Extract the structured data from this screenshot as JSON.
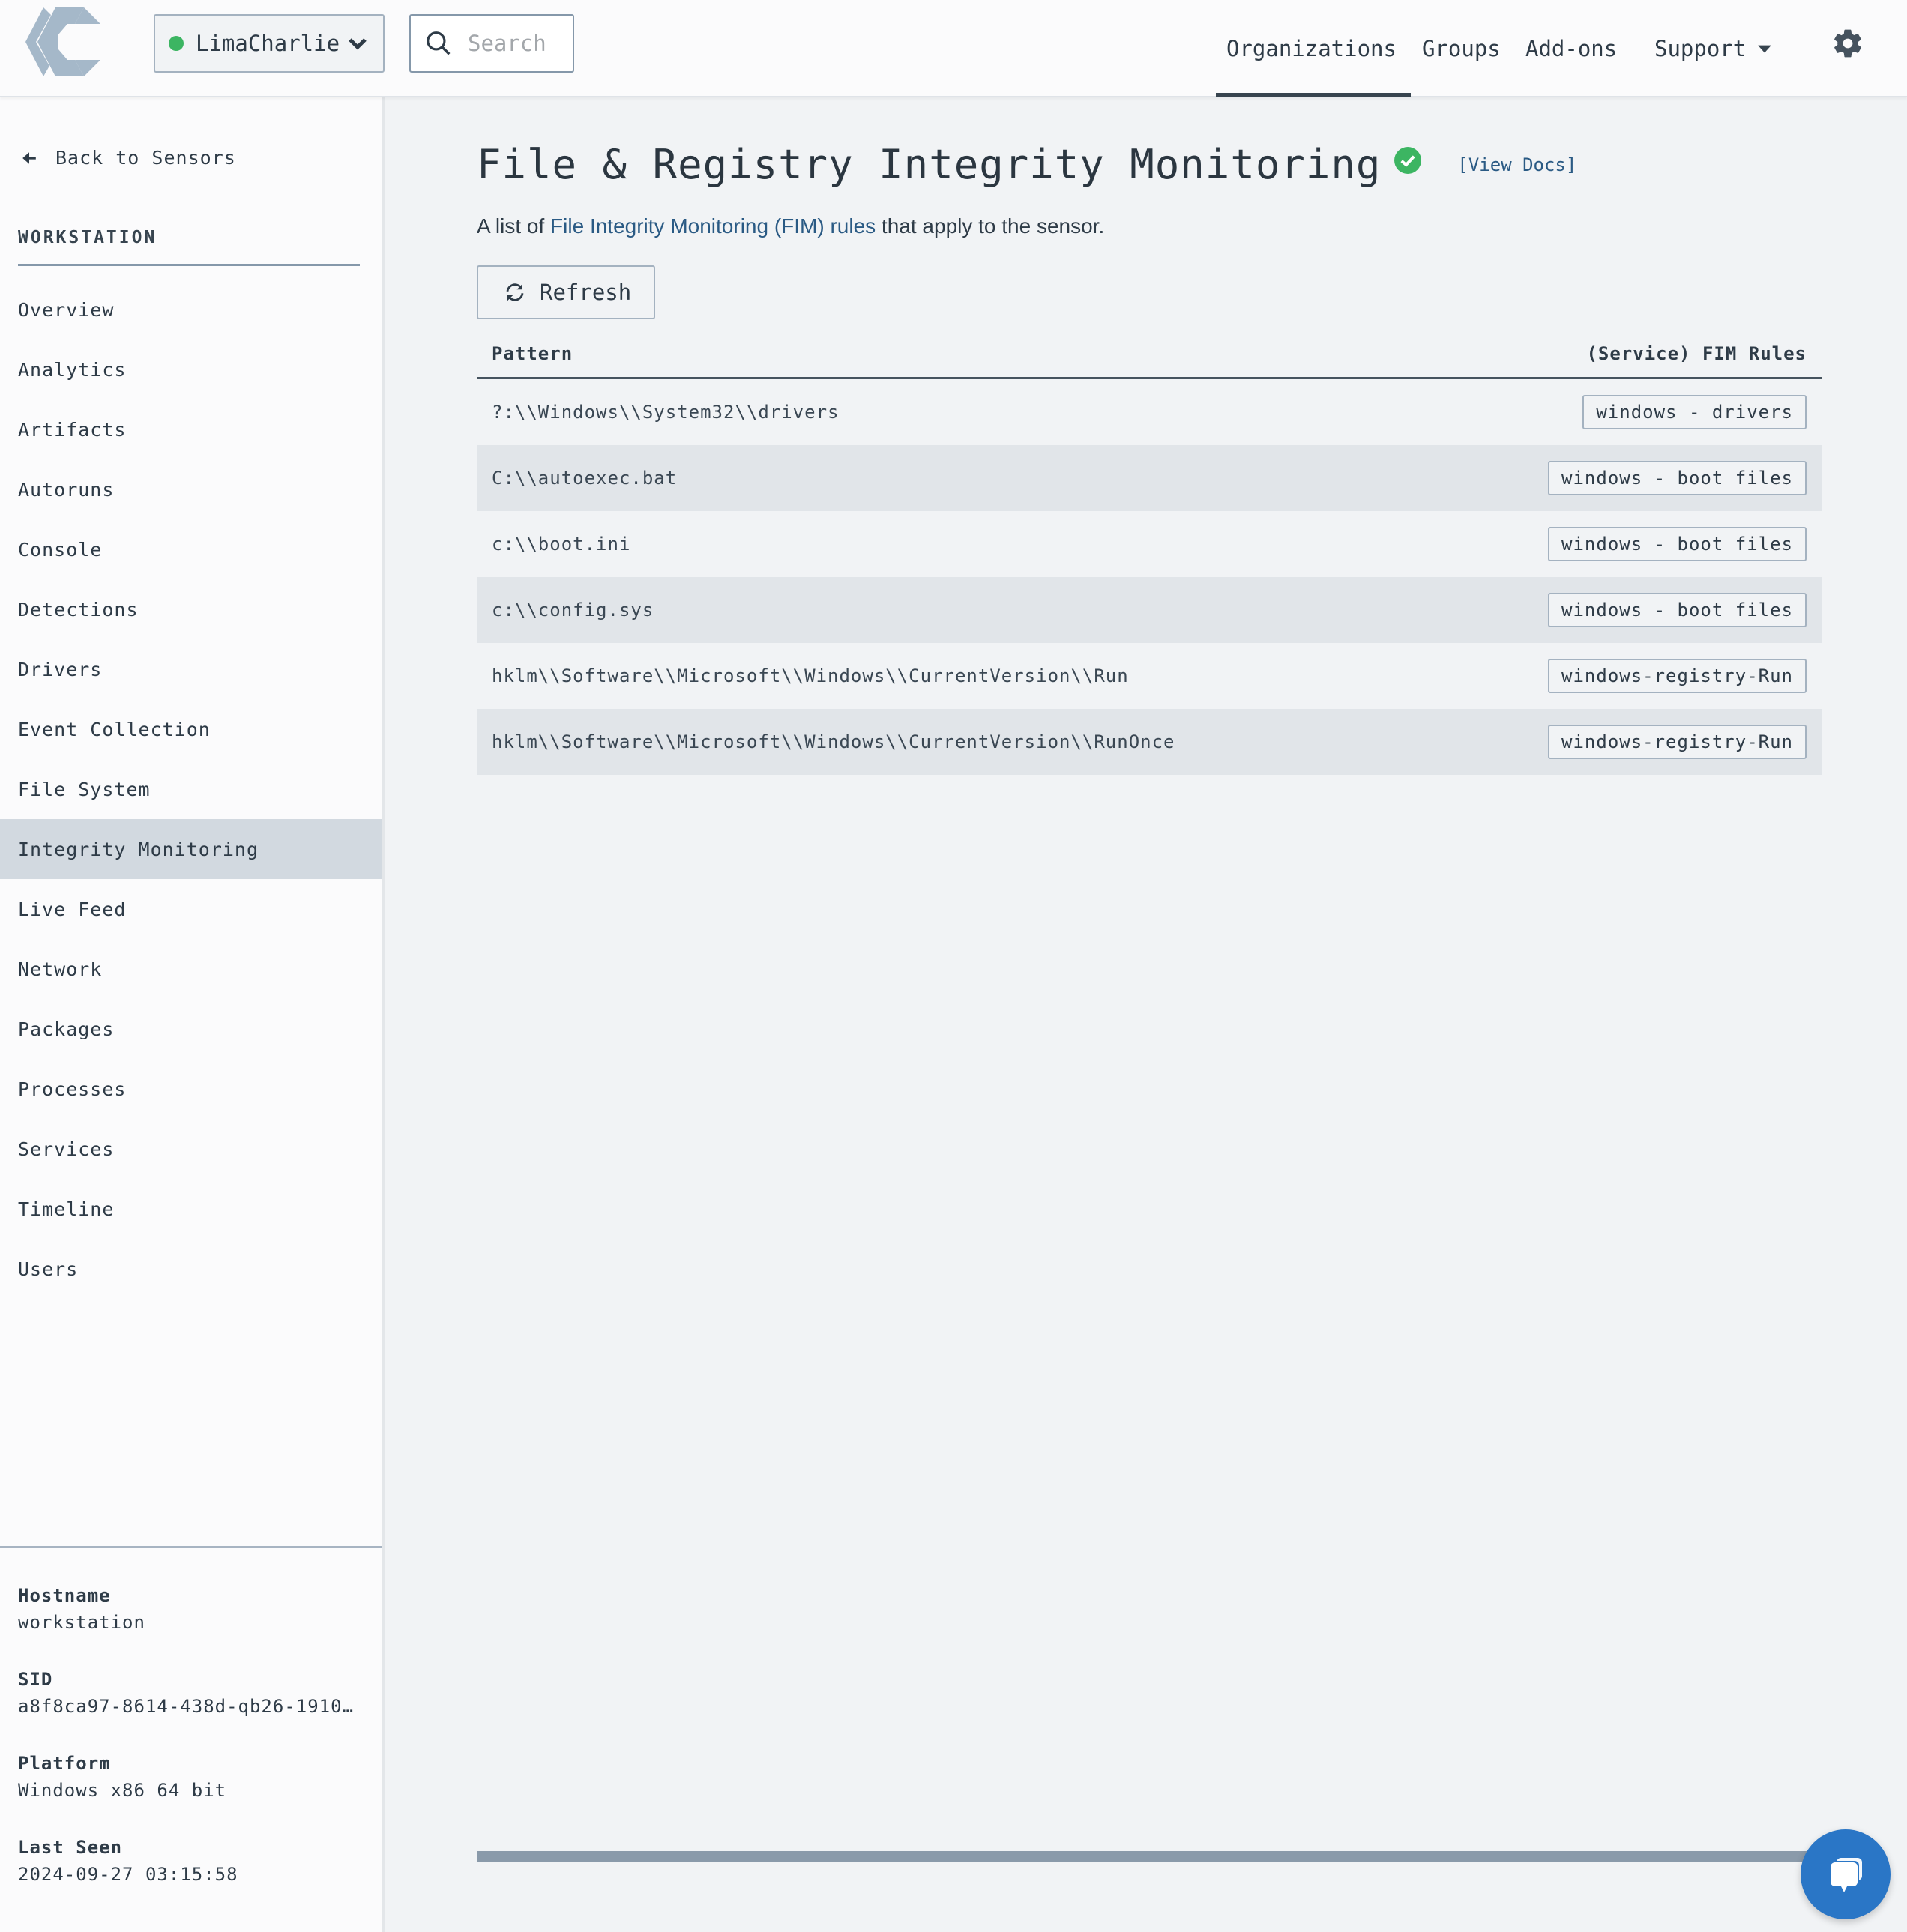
{
  "header": {
    "org": {
      "name": "LimaCharlie",
      "status_color": "#3cb562"
    },
    "search": {
      "placeholder": "Search",
      "value": ""
    },
    "nav": [
      {
        "label": "Organizations",
        "active": true
      },
      {
        "label": "Groups"
      },
      {
        "label": "Add-ons"
      },
      {
        "label": "Support",
        "has_dropdown": true
      }
    ],
    "settings_icon": "gear-icon"
  },
  "sidebar": {
    "back_label": "Back to Sensors",
    "section_title": "WORKSTATION",
    "items": [
      {
        "label": "Overview"
      },
      {
        "label": "Analytics"
      },
      {
        "label": "Artifacts"
      },
      {
        "label": "Autoruns"
      },
      {
        "label": "Console"
      },
      {
        "label": "Detections"
      },
      {
        "label": "Drivers"
      },
      {
        "label": "Event Collection"
      },
      {
        "label": "File System"
      },
      {
        "label": "Integrity Monitoring",
        "active": true
      },
      {
        "label": "Live Feed"
      },
      {
        "label": "Network"
      },
      {
        "label": "Packages"
      },
      {
        "label": "Processes"
      },
      {
        "label": "Services"
      },
      {
        "label": "Timeline"
      },
      {
        "label": "Users"
      }
    ],
    "details": [
      {
        "label": "Hostname",
        "value": "workstation"
      },
      {
        "label": "SID",
        "value": "a8f8ca97-8614-438d-qb26-1910…"
      },
      {
        "label": "Platform",
        "value": "Windows x86 64 bit"
      },
      {
        "label": "Last Seen",
        "value": "2024-09-27 03:15:58"
      }
    ]
  },
  "main": {
    "title": "File & Registry Integrity Monitoring",
    "status_icon": "check-circle-icon",
    "status_color": "#3cb562",
    "docs_link": "[View Docs]",
    "subtitle_prefix": "A list of ",
    "subtitle_link": "File Integrity Monitoring (FIM) rules",
    "subtitle_suffix": " that apply to the sensor.",
    "refresh_label": "Refresh",
    "table": {
      "columns": [
        "Pattern",
        "(Service) FIM Rules"
      ],
      "rows": [
        {
          "pattern": "?:\\\\Windows\\\\System32\\\\drivers",
          "rule": "windows - drivers"
        },
        {
          "pattern": "C:\\\\autoexec.bat",
          "rule": "windows - boot files"
        },
        {
          "pattern": "c:\\\\boot.ini",
          "rule": "windows - boot files"
        },
        {
          "pattern": "c:\\\\config.sys",
          "rule": "windows - boot files"
        },
        {
          "pattern": "hklm\\\\Software\\\\Microsoft\\\\Windows\\\\CurrentVersion\\\\Run",
          "rule": "windows-registry-Run"
        },
        {
          "pattern": "hklm\\\\Software\\\\Microsoft\\\\Windows\\\\CurrentVersion\\\\RunOnce",
          "rule": "windows-registry-Run"
        }
      ]
    }
  },
  "chat": {
    "icon": "chat-icon",
    "color": "#2a76c6"
  }
}
